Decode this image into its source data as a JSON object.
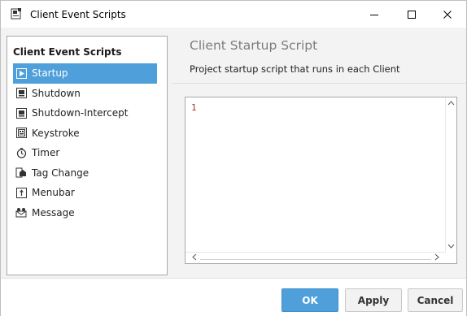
{
  "window": {
    "title": "Client Event Scripts"
  },
  "sidebar": {
    "header": "Client Event Scripts",
    "items": [
      {
        "label": "Startup",
        "icon": "startup-icon",
        "selected": true
      },
      {
        "label": "Shutdown",
        "icon": "shutdown-icon",
        "selected": false
      },
      {
        "label": "Shutdown-Intercept",
        "icon": "shutdown-intercept-icon",
        "selected": false
      },
      {
        "label": "Keystroke",
        "icon": "keystroke-icon",
        "selected": false
      },
      {
        "label": "Timer",
        "icon": "timer-icon",
        "selected": false
      },
      {
        "label": "Tag Change",
        "icon": "tag-change-icon",
        "selected": false
      },
      {
        "label": "Menubar",
        "icon": "menubar-icon",
        "selected": false
      },
      {
        "label": "Message",
        "icon": "message-icon",
        "selected": false
      }
    ]
  },
  "main": {
    "title": "Client Startup Script",
    "subtitle": "Project startup script that runs in each Client",
    "editor": {
      "line_numbers": [
        "1"
      ],
      "content": ""
    }
  },
  "footer": {
    "ok_label": "OK",
    "apply_label": "Apply",
    "cancel_label": "Cancel"
  },
  "colors": {
    "accent": "#4f9fdb",
    "selected_text": "#ffffff",
    "panel_bg": "#f3f3f3",
    "title_gray": "#7d7d7d"
  }
}
